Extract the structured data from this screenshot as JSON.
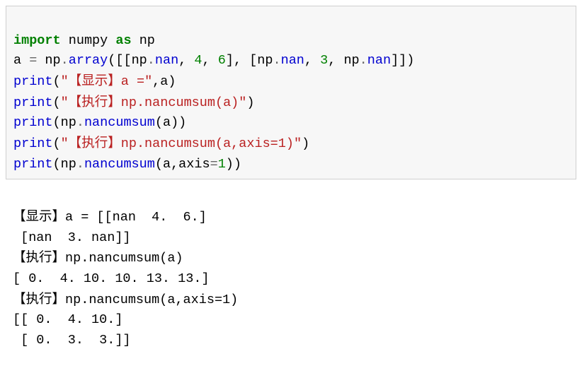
{
  "code": {
    "l1": {
      "kw_import": "import",
      "mod": "numpy",
      "kw_as": "as",
      "alias": "np"
    },
    "l2": {
      "var": "a ",
      "eq": "=",
      "sp": " np",
      "dot": ".",
      "array": "array",
      "open": "([[np",
      "nan1": "nan",
      "c1": ", ",
      "n4": "4",
      "c2": ", ",
      "n6": "6",
      "mid": "], [np",
      "nan2": "nan",
      "c3": ", ",
      "n3": "3",
      "c4": ", np",
      "nan3": "nan",
      "close": "]])"
    },
    "l3": {
      "print": "print",
      "open": "(",
      "q1": "\"",
      "cjk": "【显示】",
      "txt": "a =",
      "q2": "\"",
      "rest": ",a)"
    },
    "l4": {
      "print": "print",
      "open": "(",
      "q1": "\"",
      "cjk": "【执行】",
      "txt": "np.nancumsum(a)",
      "q2": "\"",
      "close": ")"
    },
    "l5": {
      "print": "print",
      "open": "(np",
      "dot": ".",
      "fn": "nancumsum",
      "rest": "(a))"
    },
    "l6": {
      "print": "print",
      "open": "(",
      "q1": "\"",
      "cjk": "【执行】",
      "txt": "np.nancumsum(a,axis=1)",
      "q2": "\"",
      "close": ")"
    },
    "l7": {
      "print": "print",
      "open": "(np",
      "dot": ".",
      "fn": "nancumsum",
      "mid": "(a,axis",
      "eq": "=",
      "n1": "1",
      "close": "))"
    }
  },
  "output": {
    "l1a": "【显示】",
    "l1b": "a = [[nan  4.  6.]",
    "l2": " [nan  3. nan]]",
    "l3a": "【执行】",
    "l3b": "np.nancumsum(a)",
    "l4": "[ 0.  4. 10. 10. 13. 13.]",
    "l5a": "【执行】",
    "l5b": "np.nancumsum(a,axis=1)",
    "l6": "[[ 0.  4. 10.]",
    "l7": " [ 0.  3.  3.]]"
  }
}
